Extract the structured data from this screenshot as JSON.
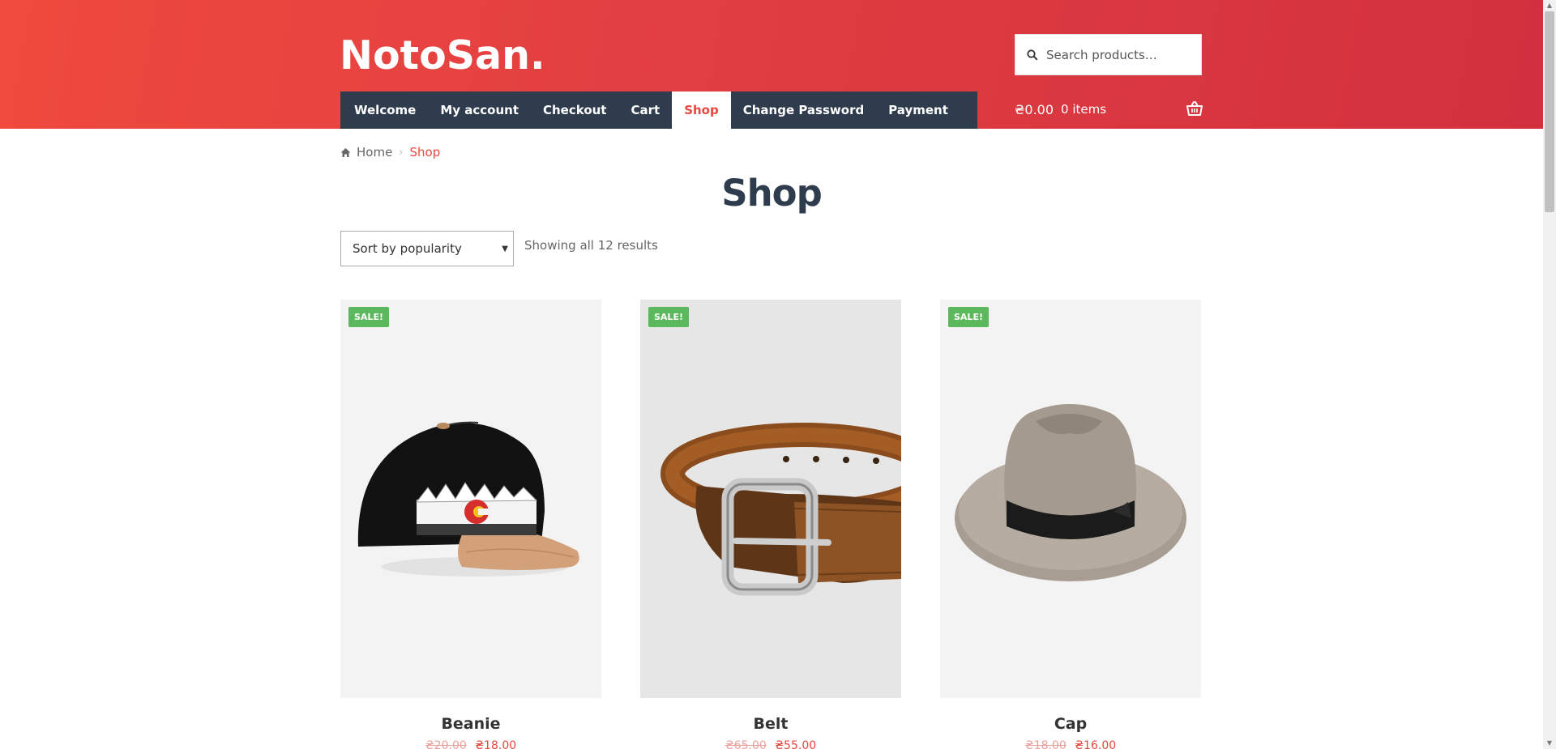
{
  "header": {
    "logo": "NotoSan.",
    "search": {
      "placeholder": "Search products…"
    },
    "nav": [
      {
        "label": "Welcome",
        "active": false
      },
      {
        "label": "My account",
        "active": false
      },
      {
        "label": "Checkout",
        "active": false
      },
      {
        "label": "Cart",
        "active": false
      },
      {
        "label": "Shop",
        "active": true
      },
      {
        "label": "Change Password",
        "active": false
      },
      {
        "label": "Payment",
        "active": false
      }
    ],
    "cart": {
      "amount": "₴0.00",
      "items": "0 items",
      "icon": "basket-icon"
    }
  },
  "breadcrumb": {
    "home": "Home",
    "current": "Shop",
    "icon": "home-icon"
  },
  "page_title": "Shop",
  "sort": {
    "selected": "Sort by popularity"
  },
  "result_count": "Showing all 12 results",
  "products": [
    {
      "name": "Beanie",
      "badge": "SALE!",
      "old_price": "₴20.00",
      "new_price": "₴18.00"
    },
    {
      "name": "Belt",
      "badge": "SALE!",
      "old_price": "₴65.00",
      "new_price": "₴55.00"
    },
    {
      "name": "Cap",
      "badge": "SALE!",
      "old_price": "₴18.00",
      "new_price": "₴16.00"
    }
  ],
  "colors": {
    "accent": "#e64840",
    "nav_bg": "#2f3c4e",
    "sale_badge": "#5cb85c"
  }
}
